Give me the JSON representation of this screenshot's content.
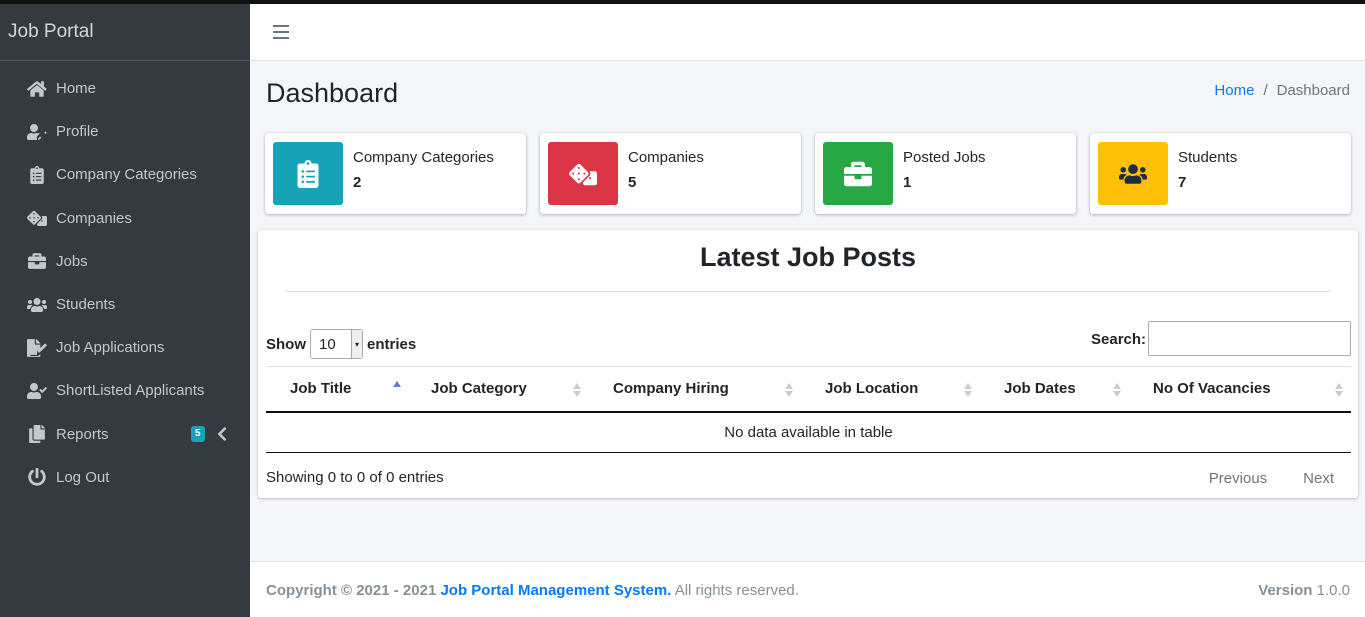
{
  "app": {
    "brand": "Job Portal"
  },
  "sidebar": {
    "items": [
      {
        "label": "Home",
        "icon": "home-icon"
      },
      {
        "label": "Profile",
        "icon": "user-edit-icon"
      },
      {
        "label": "Company Categories",
        "icon": "clipboard-list-icon"
      },
      {
        "label": "Companies",
        "icon": "dice-icon"
      },
      {
        "label": "Jobs",
        "icon": "briefcase-icon"
      },
      {
        "label": "Students",
        "icon": "users-icon"
      },
      {
        "label": "Job Applications",
        "icon": "file-signature-icon"
      },
      {
        "label": "ShortListed Applicants",
        "icon": "user-check-icon"
      },
      {
        "label": "Reports",
        "icon": "copy-icon",
        "badge": "5"
      },
      {
        "label": "Log Out",
        "icon": "power-off-icon"
      }
    ]
  },
  "header": {
    "title": "Dashboard",
    "breadcrumb": {
      "home": "Home",
      "separator": "/",
      "current": "Dashboard"
    }
  },
  "info_boxes": [
    {
      "label": "Company Categories",
      "value": "2",
      "color": "#17a2b8",
      "icon": "clipboard-list-icon"
    },
    {
      "label": "Companies",
      "value": "5",
      "color": "#dc3545",
      "icon": "dice-icon"
    },
    {
      "label": "Posted Jobs",
      "value": "1",
      "color": "#28a745",
      "icon": "briefcase-icon"
    },
    {
      "label": "Students",
      "value": "7",
      "color": "#ffc107",
      "icon": "users-icon"
    }
  ],
  "card": {
    "title": "Latest Job Posts",
    "show_label": "Show",
    "entries_value": "10",
    "entries_label": "entries",
    "search_label": "Search:",
    "search_value": "",
    "columns": [
      "Job Title",
      "Job Category",
      "Company Hiring",
      "Job Location",
      "Job Dates",
      "No Of Vacancies"
    ],
    "empty_message": "No data available in table",
    "status": "Showing 0 to 0 of 0 entries",
    "prev_label": "Previous",
    "next_label": "Next"
  },
  "footer": {
    "copyright": "Copyright © 2021 - 2021",
    "system_name": "Job Portal Management System.",
    "rights": "All rights reserved.",
    "version_label": "Version",
    "version_value": "1.0.0"
  },
  "colors": {
    "sidebar_bg": "#343a40",
    "link": "#007bff",
    "content_bg": "#f4f6f9"
  }
}
